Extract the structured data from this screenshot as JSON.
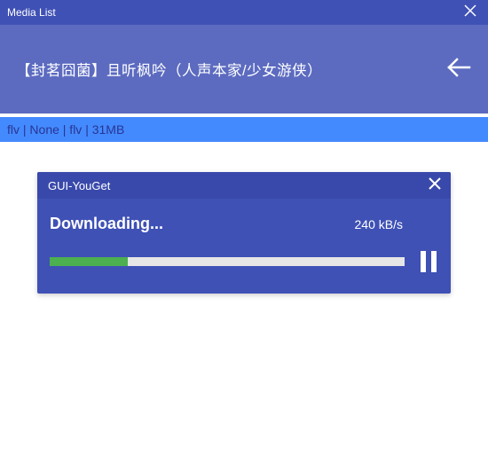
{
  "window": {
    "title": "Media List"
  },
  "header": {
    "media_title": "【封茗囧菌】且听枫吟（人声本家/少女游侠）"
  },
  "info_bar": {
    "text": "flv | None | flv | 31MB"
  },
  "download_card": {
    "title": "GUI-YouGet",
    "status_label": "Downloading...",
    "speed": "240 kB/s",
    "progress_percent": 22
  }
}
